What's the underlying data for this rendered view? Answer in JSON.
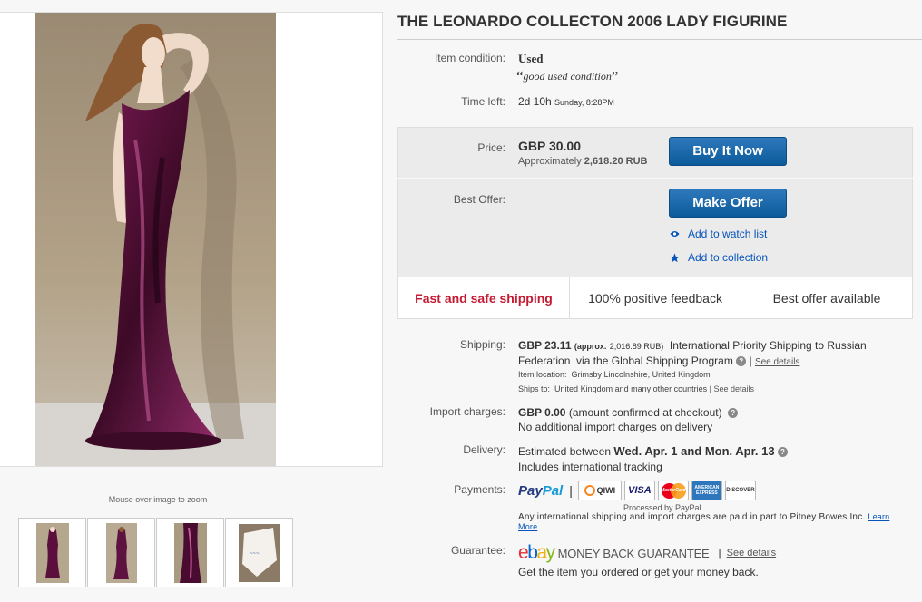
{
  "listing": {
    "title": "THE LEONARDO COLLECTON 2006 LADY FIGURINE",
    "condition_label": "Item condition:",
    "condition_value": "Used",
    "condition_note": "good used condition",
    "time_label": "Time left:",
    "time_value": "2d 10h",
    "time_detail": "Sunday, 8:28PM"
  },
  "gallery": {
    "zoom_hint": "Mouse over image to zoom",
    "thumbnail_count": 4
  },
  "buy_box": {
    "price_label": "Price:",
    "price": "GBP 30.00",
    "approx_prefix": "Approximately",
    "approx_value": "2,618.20 RUB",
    "buy_button": "Buy It Now",
    "best_offer_label": "Best Offer:",
    "offer_button": "Make Offer",
    "watch_link": "Add to watch list",
    "collection_link": "Add to collection"
  },
  "badges": [
    "Fast and safe shipping",
    "100% positive feedback",
    "Best offer available"
  ],
  "shipping": {
    "label": "Shipping:",
    "cost": "GBP 23.11",
    "approx_prefix": "(approx.",
    "approx_value": "2,016.89 RUB)",
    "service": "International Priority Shipping to Russian Federation",
    "via": "via the Global Shipping Program",
    "see_details": "See details",
    "location_label": "Item location:",
    "location": "Grimsby Lincolnshire, United Kingdom",
    "ships_to_label": "Ships to:",
    "ships_to": "United Kingdom and many other countries",
    "ships_to_details": "See details"
  },
  "import": {
    "label": "Import charges:",
    "value": "GBP 0.00",
    "value_note": "(amount confirmed at checkout)",
    "note": "No additional import charges on delivery"
  },
  "delivery": {
    "label": "Delivery:",
    "prefix": "Estimated between",
    "range": "Wed. Apr. 1 and Mon. Apr. 13",
    "tracking": "Includes international tracking"
  },
  "payments": {
    "label": "Payments:",
    "paypal_a": "Pay",
    "paypal_b": "Pal",
    "cards": [
      "QIWI",
      "VISA",
      "MasterCard",
      "AMERICAN EXPRESS",
      "DISCOVER"
    ],
    "processed": "Processed by PayPal",
    "intl_note": "Any international shipping and import charges are paid in part to Pitney Bowes Inc.",
    "learn_more": "Learn More"
  },
  "guarantee": {
    "label": "Guarantee:",
    "logo_letters": [
      "e",
      "b",
      "a",
      "y"
    ],
    "mbg": "MONEY BACK GUARANTEE",
    "see_details": "See details",
    "note": "Get the item you ordered or get your money back."
  },
  "colors": {
    "link": "#0654ba",
    "button": "#0d5a9a",
    "badge_red": "#c41a32",
    "dress": "#5a0f3c"
  },
  "icons": {
    "watch": "eye-icon",
    "collection": "star-icon",
    "help": "question-icon"
  }
}
